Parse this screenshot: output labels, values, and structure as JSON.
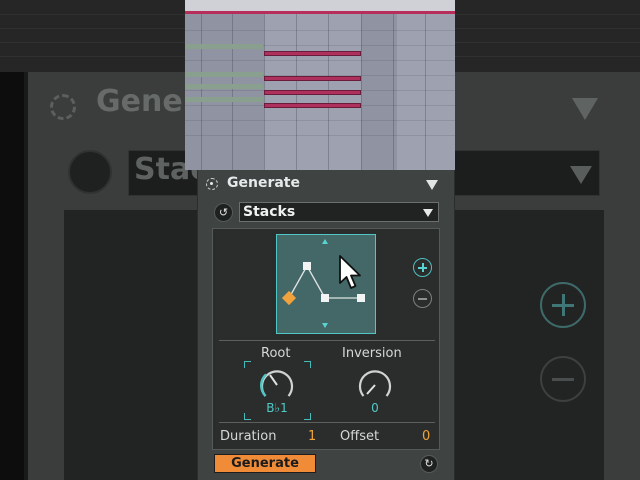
{
  "device": {
    "title": "Generate",
    "preset": "Stacks",
    "root": {
      "label": "Root",
      "value": "B♭1"
    },
    "inversion": {
      "label": "Inversion",
      "value": "0"
    },
    "duration": {
      "label": "Duration",
      "value": "1"
    },
    "offset": {
      "label": "Offset",
      "value": "0"
    },
    "generate_button": "Generate"
  },
  "background": {
    "title_echo": "Generate",
    "preset_echo": "Stacks"
  },
  "icons": {
    "header": "generator-icon",
    "reset": "reset-icon",
    "regenerate": "regenerate-icon",
    "add": "plus-icon",
    "remove": "minus-icon",
    "cursor": "mouse-pointer-icon"
  },
  "colors": {
    "accent_teal": "#50c7c4",
    "accent_orange": "#f08b37",
    "panel": "#3f4442",
    "note": "#b0305d"
  }
}
